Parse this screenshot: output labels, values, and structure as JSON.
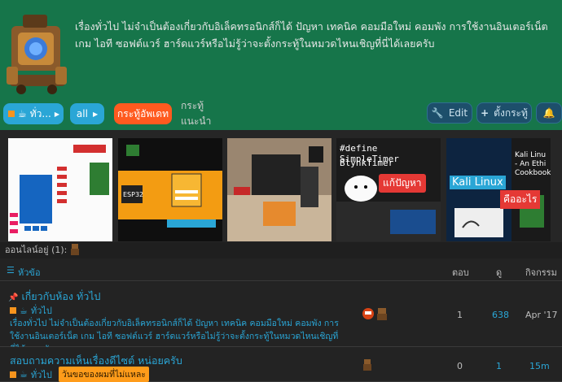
{
  "header": {
    "description": "เรื่องทั่วไป ไม่จำเป็นต้องเกี่ยวกับอิเล็คทรอนิกส์ก็ได้ ปัญหา เทคนิค คอมมือใหม่ คอมพัง การใช้งานอินเตอร์เน็ต เกม ไอที ซอฟต์แวร์ ฮาร์ดแวร์หรือไม่รู้ว่าจะตั้งกระทู้ในหมวดไหนเชิญที่นี่ได้เลยครับ"
  },
  "nav": {
    "category_label": "ทั่ว...",
    "all_label": "all",
    "latest_label": "กระทู้อัพเดท",
    "top_label": "กระทู้แนะนำ",
    "edit_label": "Edit",
    "new_topic_label": "ตั้งกระทู้"
  },
  "thumbnails": [
    {
      "name": "arduino-pinout"
    },
    {
      "name": "esp32-web"
    },
    {
      "name": "robot-arm"
    },
    {
      "name": "simpletimer",
      "line1": "#define SimpleTimer",
      "line2": "BlynkTimer",
      "badge": "แก้ปัญหา"
    },
    {
      "name": "kali-linux",
      "title": "Kali Linux",
      "badge": "คืออะไร",
      "side": "Kali Linu - An Ethi Cookbook"
    }
  ],
  "online": {
    "label": "ออนไลน์อยู่ (1):"
  },
  "table": {
    "headers": {
      "topic": "หัวข้อ",
      "replies": "ตอบ",
      "views": "ดู",
      "activity": "กิจกรรม"
    },
    "rows": [
      {
        "title": "เกี่ยวกับห้อง ทั่วไป",
        "category": "ทั่วไป",
        "excerpt": "เรื่องทั่วไป ไม่จำเป็นต้องเกี่ยวกับอิเล็คทรอนิกส์ก็ได้ ปัญหา เทคนิค คอมมือใหม่ คอมพัง การใช้งานอินเตอร์เน็ต เกม ไอที ซอฟต์แวร์ ฮาร์ดแวร์หรือไม่รู้ว่าจะตั้งกระทู้ในหมวดไหนเชิญที่นี่ได้เลยครับ",
        "replies": "1",
        "views": "638",
        "activity": "Apr '17"
      },
      {
        "title": "สอบถามความเห็นเรื่องดีไซต์ หน่อยครับ",
        "category": "ทั่วไป",
        "tag": "วันขอของผมที่ไม่แหละ",
        "replies": "0",
        "views": "1",
        "activity": "15m"
      }
    ]
  },
  "colors": {
    "header_bg": "#16754a",
    "accent": "#2aa6d6",
    "orange": "#ff5a1f",
    "category_square": "#f7941d"
  }
}
